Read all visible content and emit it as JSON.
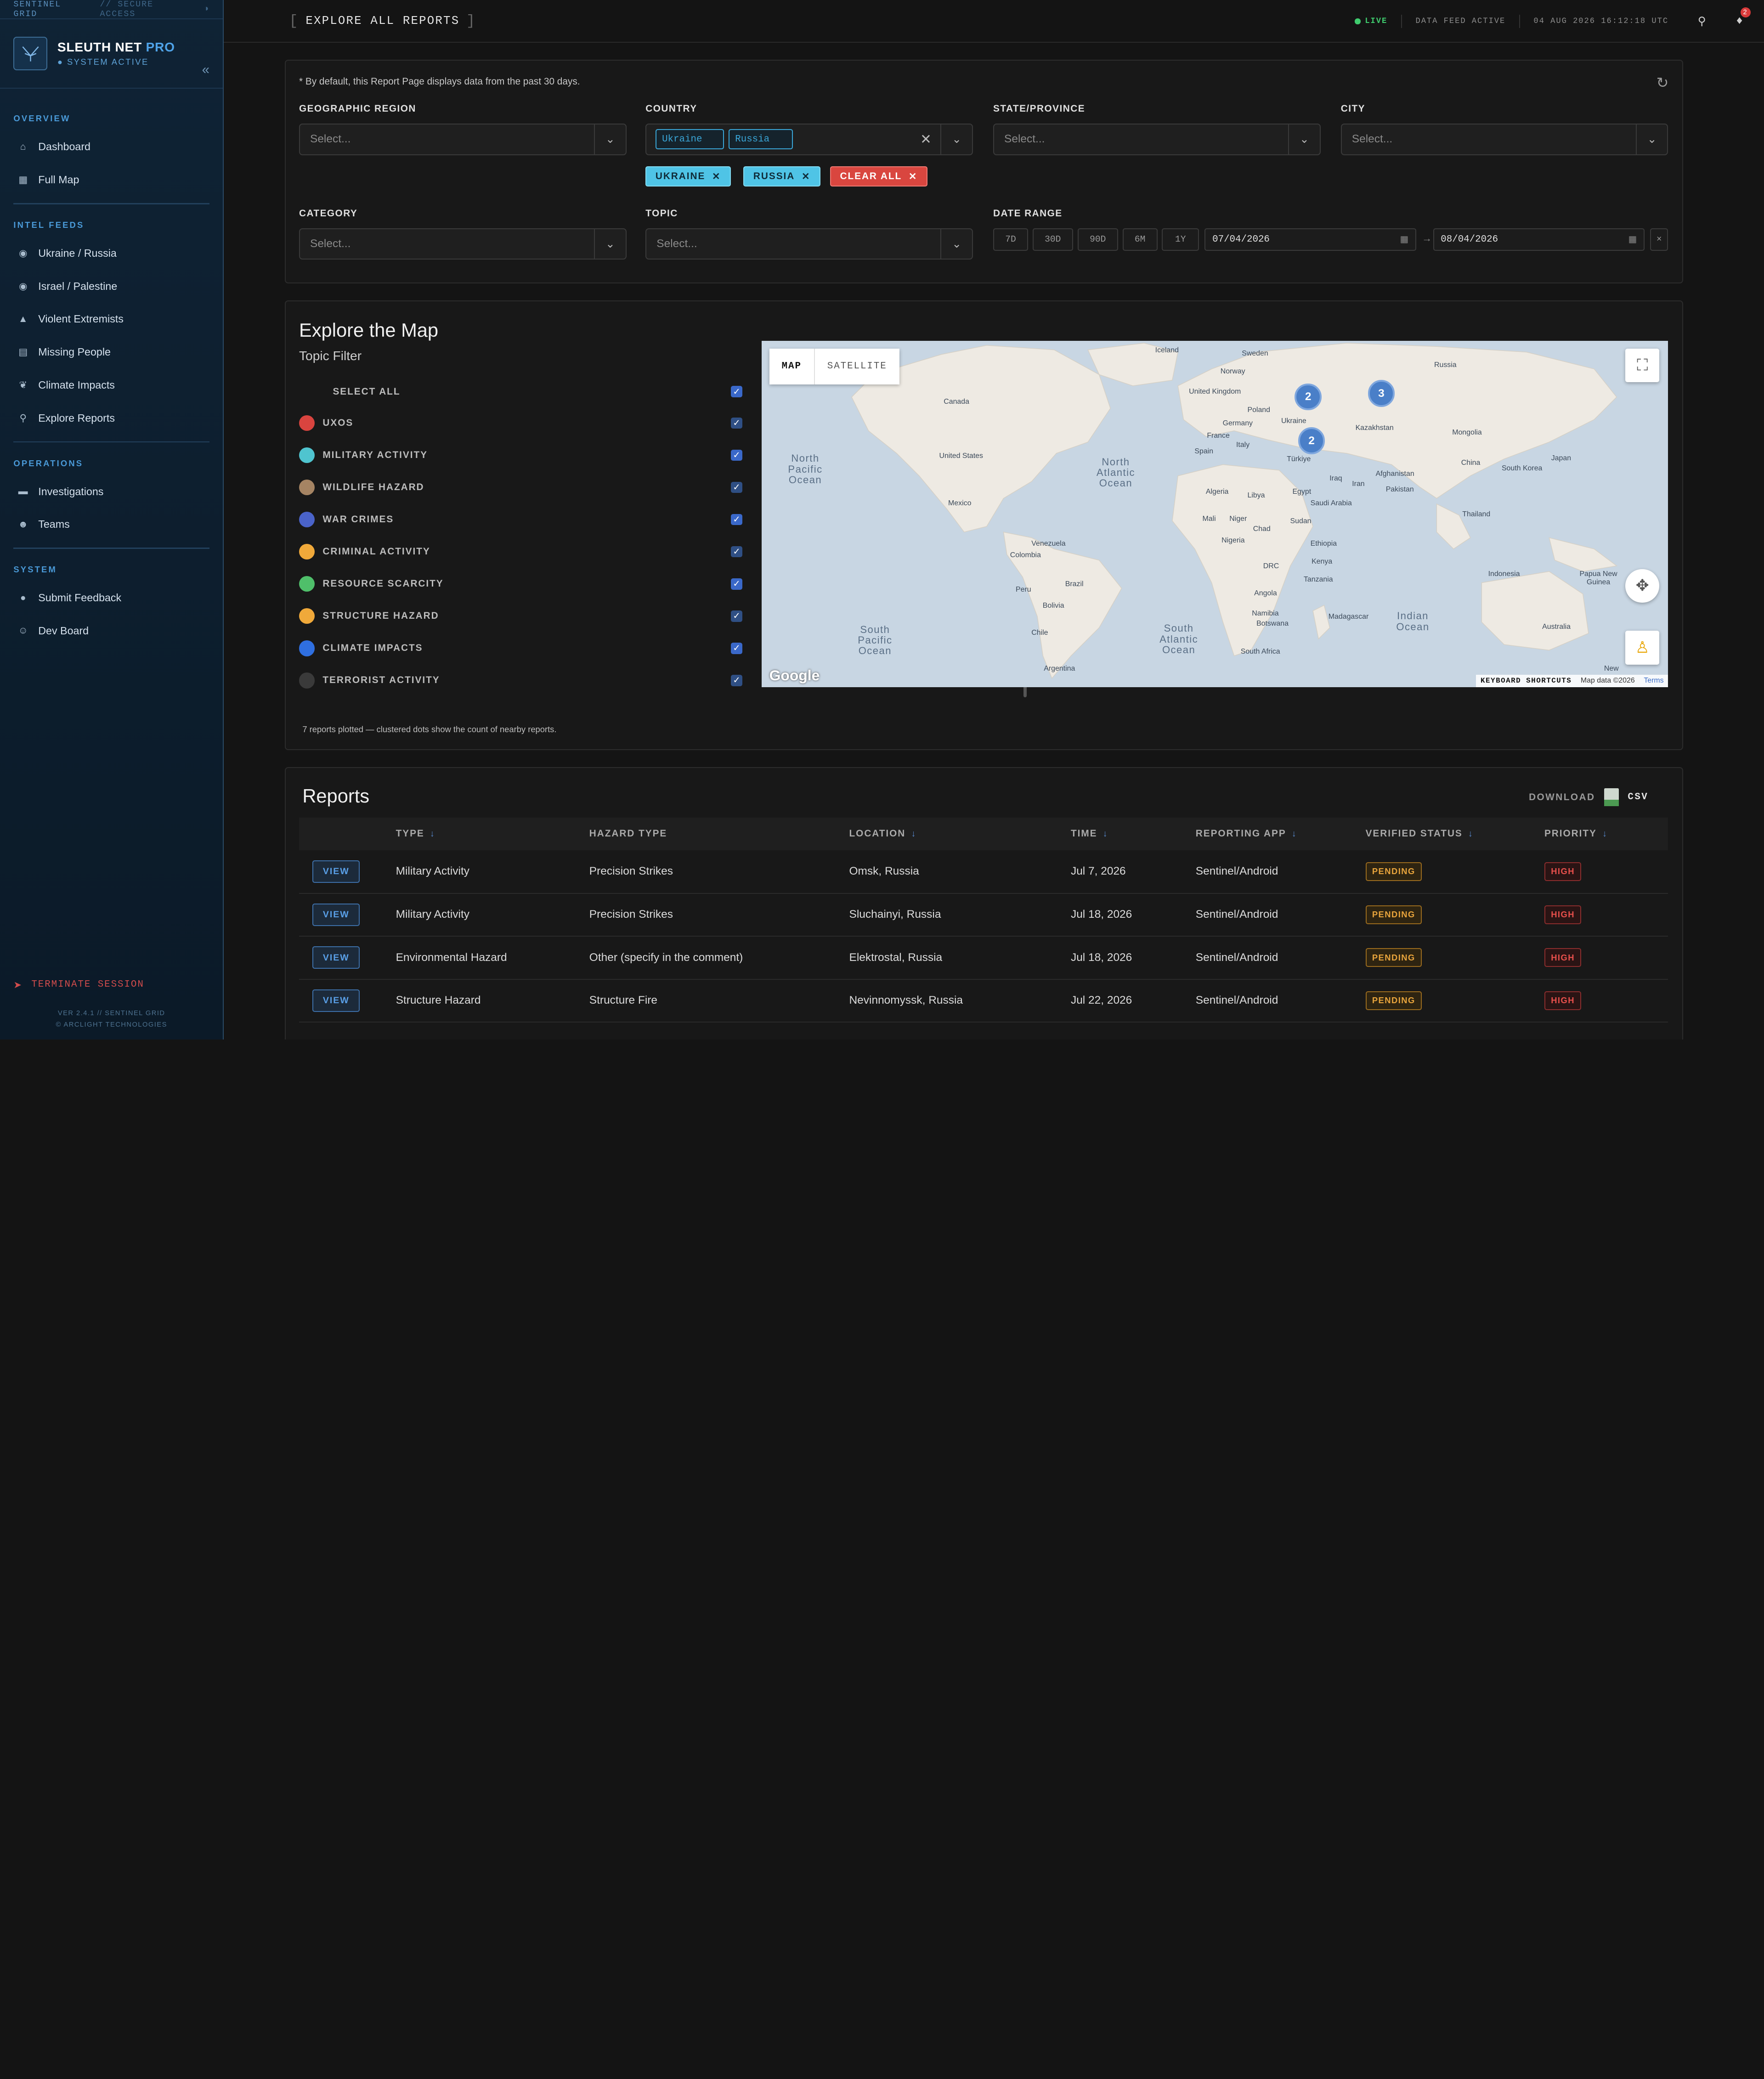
{
  "sidebar": {
    "topstrip": {
      "left": "SENTINEL GRID",
      "right": "// SECURE ACCESS"
    },
    "brand": {
      "name": "SLEUTH NET",
      "pro": "PRO",
      "status": "SYSTEM ACTIVE"
    },
    "sections": [
      {
        "title": "OVERVIEW",
        "items": [
          {
            "label": "Dashboard",
            "icon": "home-icon"
          },
          {
            "label": "Full Map",
            "icon": "map-icon"
          }
        ]
      },
      {
        "title": "INTEL FEEDS",
        "items": [
          {
            "label": "Ukraine / Russia",
            "icon": "globe-icon"
          },
          {
            "label": "Israel / Palestine",
            "icon": "globe-icon"
          },
          {
            "label": "Violent Extremists",
            "icon": "warning-icon"
          },
          {
            "label": "Missing People",
            "icon": "building-icon"
          },
          {
            "label": "Climate Impacts",
            "icon": "leaf-icon"
          },
          {
            "label": "Explore Reports",
            "icon": "search-icon"
          }
        ]
      },
      {
        "title": "OPERATIONS",
        "items": [
          {
            "label": "Investigations",
            "icon": "folder-icon"
          },
          {
            "label": "Teams",
            "icon": "users-icon"
          }
        ]
      },
      {
        "title": "SYSTEM",
        "items": [
          {
            "label": "Submit Feedback",
            "icon": "chat-icon"
          },
          {
            "label": "Dev Board",
            "icon": "user-gear-icon"
          }
        ]
      }
    ],
    "terminate": "TERMINATE SESSION",
    "version": "VER 2.4.1 // SENTINEL GRID",
    "copyright": "© ARCLIGHT TECHNOLOGIES"
  },
  "header": {
    "title": "EXPLORE ALL REPORTS",
    "live": "LIVE",
    "feed": "DATA FEED ACTIVE",
    "datetime": "04 AUG 2026 16:12:18 UTC",
    "notifications": "2"
  },
  "filters": {
    "note": "* By default, this Report Page displays data from the past 30 days.",
    "geo_label": "GEOGRAPHIC REGION",
    "country_label": "COUNTRY",
    "state_label": "STATE/PROVINCE",
    "city_label": "CITY",
    "category_label": "CATEGORY",
    "topic_label": "TOPIC",
    "date_label": "DATE RANGE",
    "placeholder": "Select...",
    "country_chips": [
      "Ukraine",
      "Russia"
    ],
    "tags": [
      "UKRAINE",
      "RUSSIA"
    ],
    "clear_all": "CLEAR ALL",
    "ranges": [
      "7D",
      "30D",
      "90D",
      "6M",
      "1Y"
    ],
    "date_from": "07/04/2026",
    "date_to": "08/04/2026"
  },
  "map_section": {
    "title": "Explore the Map",
    "subtitle": "Topic Filter",
    "select_all": "SELECT ALL",
    "topics": [
      {
        "label": "UXOS",
        "color": "#d9443f",
        "checked": true
      },
      {
        "label": "MILITARY ACTIVITY",
        "color": "#4fc4cf",
        "checked": true
      },
      {
        "label": "WILDLIFE HAZARD",
        "color": "#a58463",
        "checked": true
      },
      {
        "label": "WAR CRIMES",
        "color": "#4a63c9",
        "checked": true
      },
      {
        "label": "CRIMINAL ACTIVITY",
        "color": "#f0a93a",
        "checked": true
      },
      {
        "label": "RESOURCE SCARCITY",
        "color": "#4fbf6a",
        "checked": true
      },
      {
        "label": "STRUCTURE HAZARD",
        "color": "#f0a93a",
        "checked": true
      },
      {
        "label": "CLIMATE IMPACTS",
        "color": "#2f6fe0",
        "checked": true
      },
      {
        "label": "TERRORIST ACTIVITY",
        "color": "#3a3a3a",
        "checked": true
      }
    ],
    "footnote": "7 reports plotted — clustered dots show the count of nearby reports.",
    "map": {
      "type_map": "MAP",
      "type_satellite": "SATELLITE",
      "clusters": [
        "2",
        "3",
        "2"
      ],
      "google": "Google",
      "keyboard": "KEYBOARD SHORTCUTS",
      "mapdata": "Map data ©2026",
      "terms": "Terms",
      "labels": [
        "Iceland",
        "Sweden",
        "Norway",
        "Russia",
        "Canada",
        "United Kingdom",
        "Poland",
        "Ukraine",
        "Germany",
        "Kazakhstan",
        "France",
        "Mongolia",
        "Spain",
        "Italy",
        "Türkiye",
        "United States",
        "China",
        "South Korea",
        "Japan",
        "Iraq",
        "Afghanistan",
        "Iran",
        "Algeria",
        "Libya",
        "Egypt",
        "Pakistan",
        "Saudi Arabia",
        "Mexico",
        "Mali",
        "Niger",
        "Sudan",
        "Chad",
        "Nigeria",
        "Ethiopia",
        "Thailand",
        "Venezuela",
        "Colombia",
        "Kenya",
        "DRC",
        "Tanzania",
        "Indonesia",
        "Papua New Guinea",
        "Brazil",
        "Peru",
        "Bolivia",
        "Angola",
        "Namibia",
        "Botswana",
        "Madagascar",
        "Australia",
        "Chile",
        "Argentina",
        "South Africa",
        "New"
      ],
      "oceans": [
        "North Pacific Ocean",
        "North Atlantic Ocean",
        "South Pacific Ocean",
        "South Atlantic Ocean",
        "Indian Ocean"
      ]
    }
  },
  "reports": {
    "title": "Reports",
    "download": "DOWNLOAD",
    "csv": "CSV",
    "columns": [
      "",
      "TYPE",
      "HAZARD TYPE",
      "LOCATION",
      "TIME",
      "REPORTING APP",
      "VERIFIED STATUS",
      "PRIORITY"
    ],
    "view": "VIEW",
    "rows": [
      {
        "type": "Military Activity",
        "hazard": "Precision Strikes",
        "location": "Omsk, Russia",
        "time": "Jul 7, 2026",
        "app": "Sentinel/Android",
        "status": "PENDING",
        "priority": "HIGH"
      },
      {
        "type": "Military Activity",
        "hazard": "Precision Strikes",
        "location": "Sluchainyi, Russia",
        "time": "Jul 18, 2026",
        "app": "Sentinel/Android",
        "status": "PENDING",
        "priority": "HIGH"
      },
      {
        "type": "Environmental Hazard",
        "hazard": "Other (specify in the comment)",
        "location": "Elektrostal, Russia",
        "time": "Jul 18, 2026",
        "app": "Sentinel/Android",
        "status": "PENDING",
        "priority": "HIGH"
      },
      {
        "type": "Structure Hazard",
        "hazard": "Structure Fire",
        "location": "Nevinnomyssk, Russia",
        "time": "Jul 22, 2026",
        "app": "Sentinel/Android",
        "status": "PENDING",
        "priority": "HIGH"
      }
    ]
  }
}
